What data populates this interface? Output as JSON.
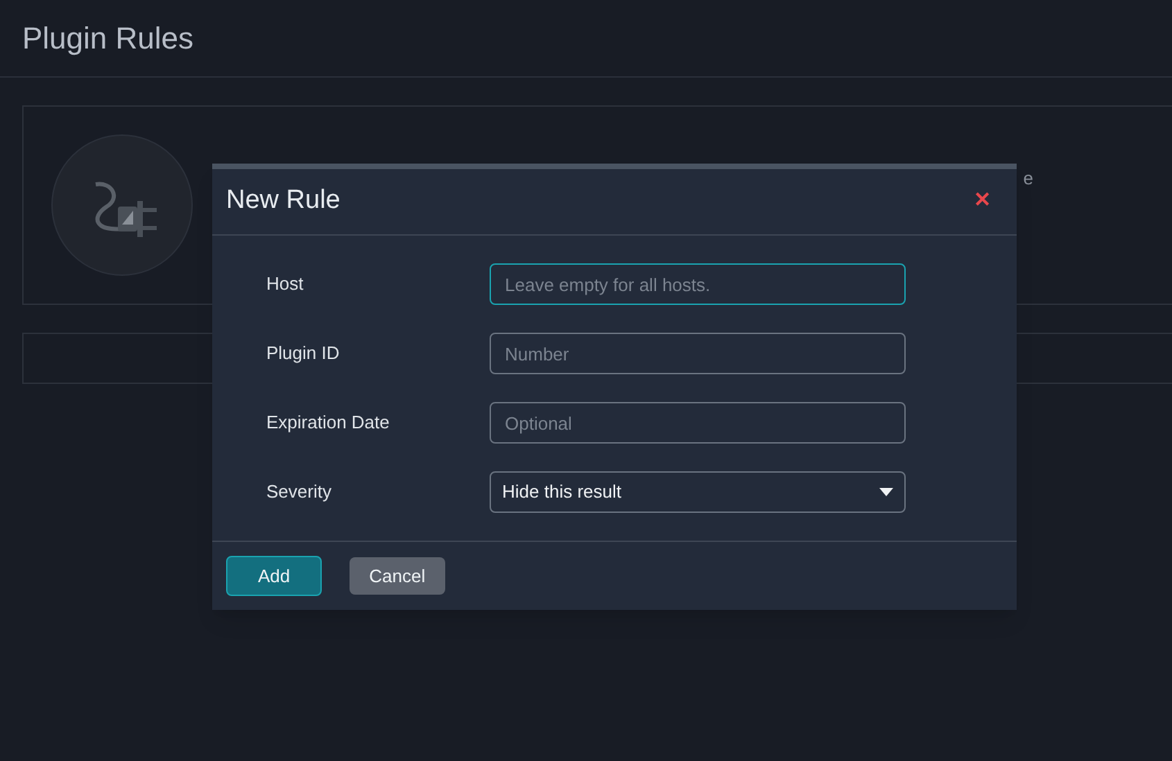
{
  "page": {
    "title": "Plugin Rules"
  },
  "background_card": {
    "text_fragment": "e"
  },
  "dialog": {
    "title": "New Rule",
    "close": "✕",
    "fields": [
      {
        "label": "Host",
        "kind": "text",
        "placeholder": "Leave empty for all hosts.",
        "focused": true
      },
      {
        "label": "Plugin ID",
        "kind": "text",
        "placeholder": "Number",
        "focused": false
      },
      {
        "label": "Expiration Date",
        "kind": "text",
        "placeholder": "Optional",
        "focused": false
      },
      {
        "label": "Severity",
        "kind": "select",
        "value": "Hide this result",
        "focused": false
      }
    ],
    "buttons": [
      {
        "label": "Add",
        "kind": "primary"
      },
      {
        "label": "Cancel",
        "kind": "secondary"
      }
    ]
  }
}
